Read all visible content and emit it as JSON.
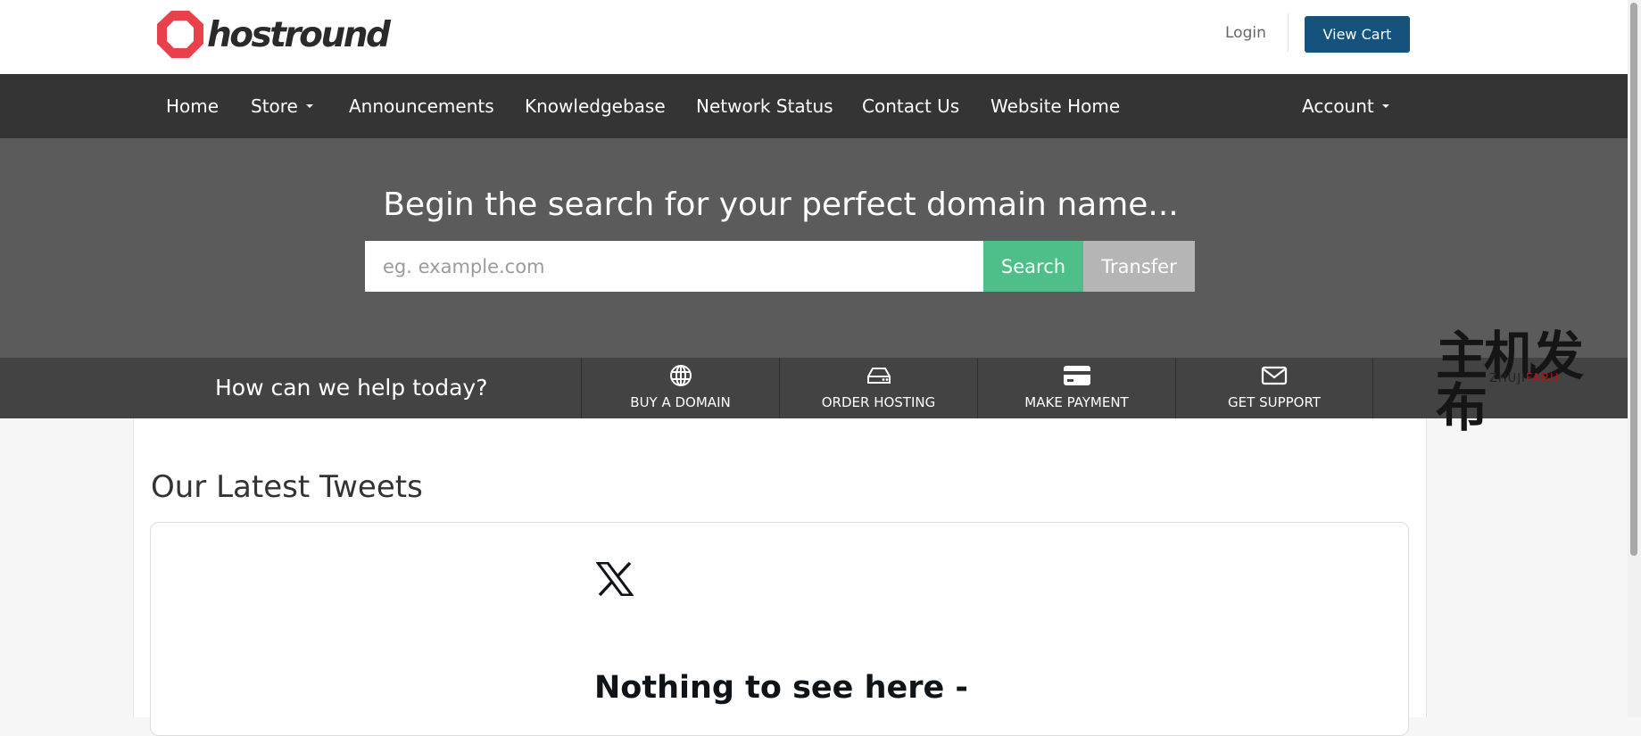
{
  "header": {
    "brand": "hostround",
    "login_label": "Login",
    "view_cart_label": "View Cart",
    "logo_color": "#e8414b"
  },
  "nav": {
    "items": [
      {
        "label": "Home"
      },
      {
        "label": "Store"
      },
      {
        "label": "Announcements"
      },
      {
        "label": "Knowledgebase"
      },
      {
        "label": "Network Status"
      },
      {
        "label": "Contact Us"
      },
      {
        "label": "Website Home"
      }
    ],
    "account_label": "Account"
  },
  "search": {
    "title": "Begin the search for your perfect domain name...",
    "placeholder": "eg. example.com",
    "search_label": "Search",
    "transfer_label": "Transfer"
  },
  "help": {
    "prompt": "How can we help today?",
    "tiles": [
      {
        "label": "BUY A DOMAIN",
        "icon": "globe-icon"
      },
      {
        "label": "ORDER HOSTING",
        "icon": "hard-drive-icon"
      },
      {
        "label": "MAKE PAYMENT",
        "icon": "credit-card-icon"
      },
      {
        "label": "GET SUPPORT",
        "icon": "envelope-icon"
      }
    ]
  },
  "watermark": {
    "main": "主机发布",
    "sub_left": "ZHUJI",
    "sub_right": "FABU"
  },
  "tweets": {
    "title": "Our Latest Tweets",
    "empty_message": "Nothing to see here -"
  },
  "colors": {
    "nav_bg": "#343434",
    "hero_bg": "#5b5b5b",
    "helpbar_bg": "#434343",
    "cart_button": "#15527e",
    "search_button": "#4ebf88",
    "transfer_button": "#b5b5b5"
  }
}
